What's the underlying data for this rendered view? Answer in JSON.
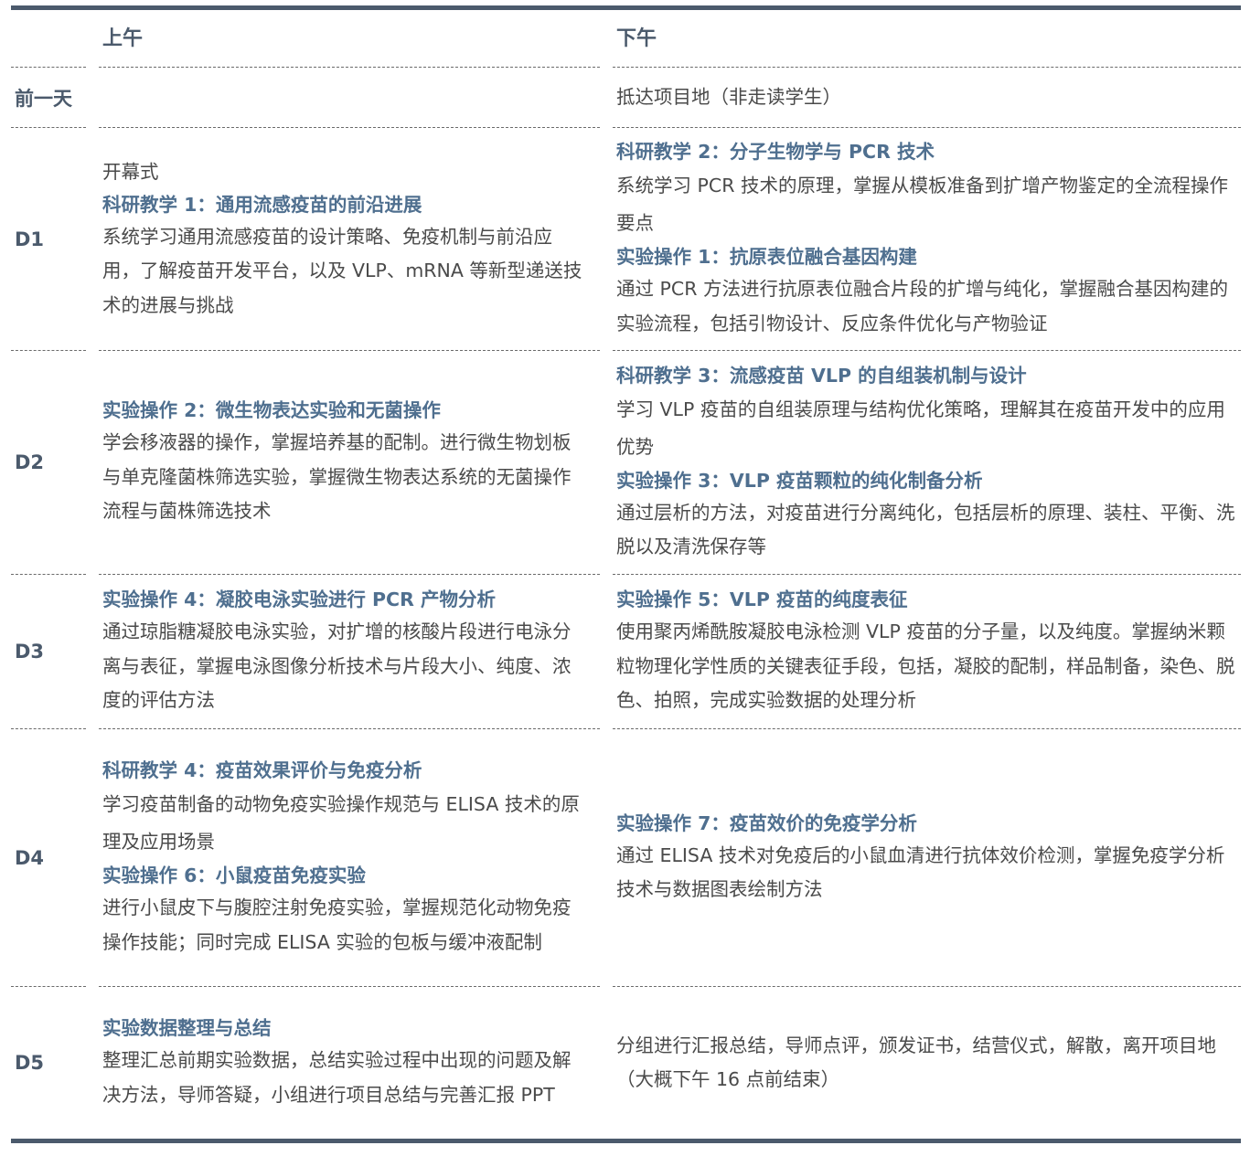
{
  "header": {
    "morning": "上午",
    "afternoon": "下午"
  },
  "rows": [
    {
      "day": "前一天",
      "morning": [],
      "afternoon": [
        {
          "title": "",
          "desc": "抵达项目地（非走读学生）"
        }
      ]
    },
    {
      "day": "D1",
      "morning": [
        {
          "title": "",
          "desc": "开幕式"
        },
        {
          "title": "科研教学 1：通用流感疫苗的前沿进展",
          "desc": "系统学习通用流感疫苗的设计策略、免疫机制与前沿应用，了解疫苗开发平台，以及 VLP、mRNA 等新型递送技术的进展与挑战"
        }
      ],
      "afternoon": [
        {
          "title": "科研教学 2：分子生物学与 PCR 技术",
          "desc": "系统学习 PCR 技术的原理，掌握从模板准备到扩增产物鉴定的全流程操作要点"
        },
        {
          "title": "实验操作 1：抗原表位融合基因构建",
          "desc": "通过 PCR 方法进行抗原表位融合片段的扩增与纯化，掌握融合基因构建的实验流程，包括引物设计、反应条件优化与产物验证"
        }
      ]
    },
    {
      "day": "D2",
      "morning": [
        {
          "title": "实验操作 2：微生物表达实验和无菌操作",
          "desc": "学会移液器的操作，掌握培养基的配制。进行微生物划板与单克隆菌株筛选实验，掌握微生物表达系统的无菌操作流程与菌株筛选技术"
        }
      ],
      "afternoon": [
        {
          "title": "科研教学 3：流感疫苗 VLP 的自组装机制与设计",
          "desc": "学习 VLP 疫苗的自组装原理与结构优化策略，理解其在疫苗开发中的应用优势"
        },
        {
          "title": "实验操作 3：VLP 疫苗颗粒的纯化制备分析",
          "desc": "通过层析的方法，对疫苗进行分离纯化，包括层析的原理、装柱、平衡、洗脱以及清洗保存等"
        }
      ]
    },
    {
      "day": "D3",
      "morning": [
        {
          "title": "实验操作 4：凝胶电泳实验进行 PCR 产物分析",
          "desc": "通过琼脂糖凝胶电泳实验，对扩增的核酸片段进行电泳分离与表征，掌握电泳图像分析技术与片段大小、纯度、浓度的评估方法"
        }
      ],
      "afternoon": [
        {
          "title": "实验操作 5：VLP 疫苗的纯度表征",
          "desc": "使用聚丙烯酰胺凝胶电泳检测 VLP 疫苗的分子量，以及纯度。掌握纳米颗粒物理化学性质的关键表征手段，包括，凝胶的配制，样品制备，染色、脱色、拍照，完成实验数据的处理分析"
        }
      ]
    },
    {
      "day": "D4",
      "morning": [
        {
          "title": "科研教学 4：疫苗效果评价与免疫分析",
          "desc": "学习疫苗制备的动物免疫实验操作规范与 ELISA 技术的原理及应用场景"
        },
        {
          "title": "实验操作 6：小鼠疫苗免疫实验",
          "desc": "进行小鼠皮下与腹腔注射免疫实验，掌握规范化动物免疫操作技能；同时完成 ELISA 实验的包板与缓冲液配制"
        }
      ],
      "afternoon": [
        {
          "title": "实验操作 7：疫苗效价的免疫学分析",
          "desc": "通过 ELISA 技术对免疫后的小鼠血清进行抗体效价检测，掌握免疫学分析技术与数据图表绘制方法"
        }
      ]
    },
    {
      "day": "D5",
      "morning": [
        {
          "title": "实验数据整理与总结",
          "desc": "整理汇总前期实验数据，总结实验过程中出现的问题及解决方法，导师答疑，小组进行项目总结与完善汇报 PPT"
        }
      ],
      "afternoon": [
        {
          "title": "",
          "desc": "分组进行汇报总结，导师点评，颁发证书，结营仪式，解散，离开项目地（大概下午 16 点前结束）"
        }
      ]
    }
  ]
}
